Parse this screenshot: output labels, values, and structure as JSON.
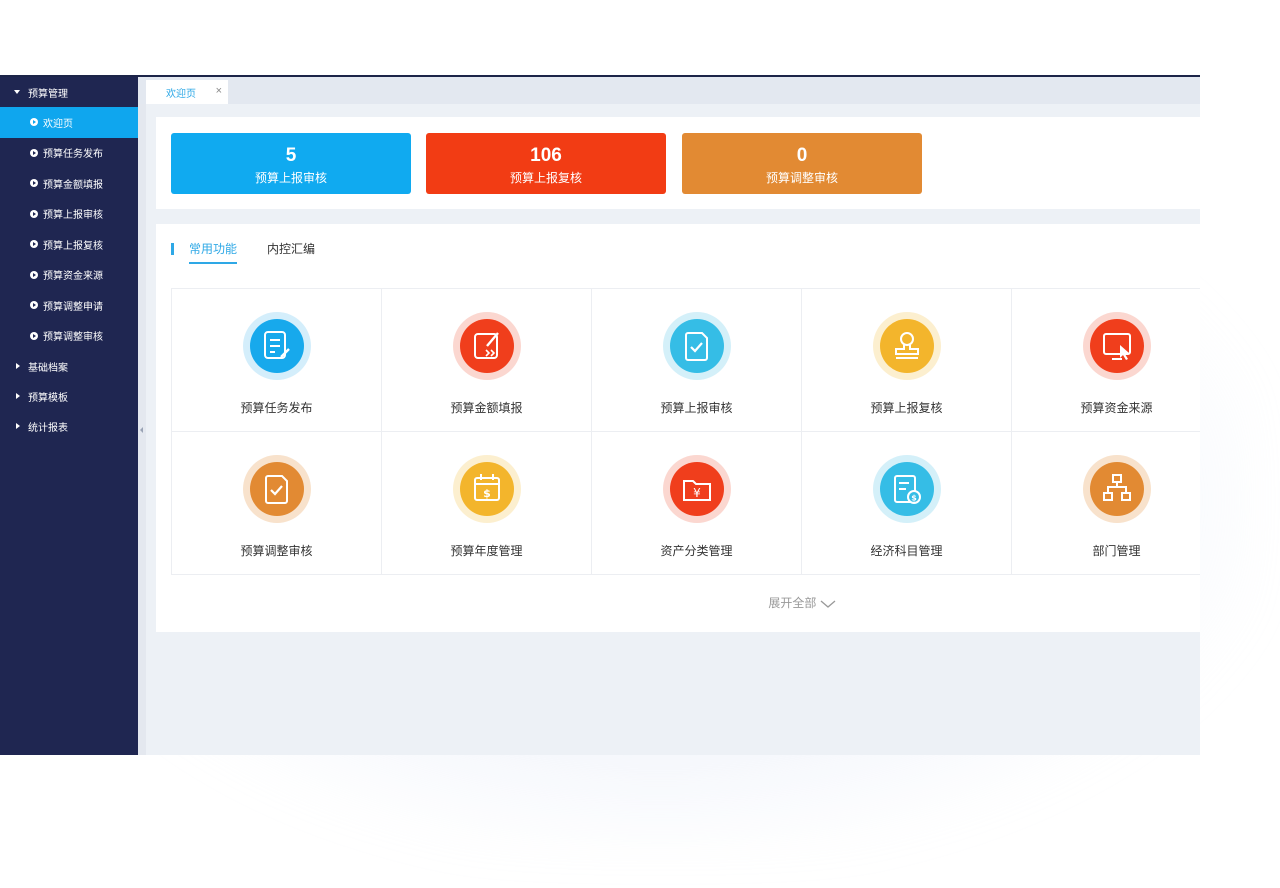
{
  "sidebar": {
    "groups": [
      {
        "label": "预算管理",
        "expanded": true
      },
      {
        "label": "基础档案",
        "expanded": false
      },
      {
        "label": "预算模板",
        "expanded": false
      },
      {
        "label": "统计报表",
        "expanded": false
      }
    ],
    "items": [
      {
        "label": "欢迎页",
        "active": true
      },
      {
        "label": "预算任务发布"
      },
      {
        "label": "预算金额填报"
      },
      {
        "label": "预算上报审核"
      },
      {
        "label": "预算上报复核"
      },
      {
        "label": "预算资金来源"
      },
      {
        "label": "预算调整申请"
      },
      {
        "label": "预算调整审核"
      }
    ]
  },
  "tabs": [
    {
      "label": "欢迎页",
      "close": "×"
    }
  ],
  "stats": [
    {
      "value": "5",
      "label": "预算上报审核",
      "color": "#10aaf0"
    },
    {
      "value": "106",
      "label": "预算上报复核",
      "color": "#f23c14"
    },
    {
      "value": "0",
      "label": "预算调整审核",
      "color": "#e28a33"
    }
  ],
  "func_tabs": [
    {
      "label": "常用功能",
      "active": true
    },
    {
      "label": "内控汇编",
      "active": false
    }
  ],
  "functions": [
    {
      "label": "预算任务发布",
      "icon": "document-edit-icon",
      "color": "#17a9ec",
      "halo": "#d4eefb"
    },
    {
      "label": "预算金额填报",
      "icon": "pen-edit-icon",
      "color": "#f03e1c",
      "halo": "#fbd7d0"
    },
    {
      "label": "预算上报审核",
      "icon": "clipboard-check-icon",
      "color": "#35bde6",
      "halo": "#d4f0f9"
    },
    {
      "label": "预算上报复核",
      "icon": "stamp-icon",
      "color": "#f3b52c",
      "halo": "#fcefcf"
    },
    {
      "label": "预算资金来源",
      "icon": "screen-cursor-icon",
      "color": "#f03e1c",
      "halo": "#fbd7d0"
    },
    {
      "label": "预算调整审核",
      "icon": "clipboard-check-icon",
      "color": "#e28a33",
      "halo": "#f8e2cc"
    },
    {
      "label": "预算年度管理",
      "icon": "calendar-dollar-icon",
      "color": "#f3b52c",
      "halo": "#fcefcf"
    },
    {
      "label": "资产分类管理",
      "icon": "folder-yen-icon",
      "color": "#f03e1c",
      "halo": "#fbd7d0"
    },
    {
      "label": "经济科目管理",
      "icon": "receipt-dollar-icon",
      "color": "#35bde6",
      "halo": "#d4f0f9"
    },
    {
      "label": "部门管理",
      "icon": "org-chart-icon",
      "color": "#e28a33",
      "halo": "#f8e2cc"
    }
  ],
  "expand_label": "展开全部"
}
